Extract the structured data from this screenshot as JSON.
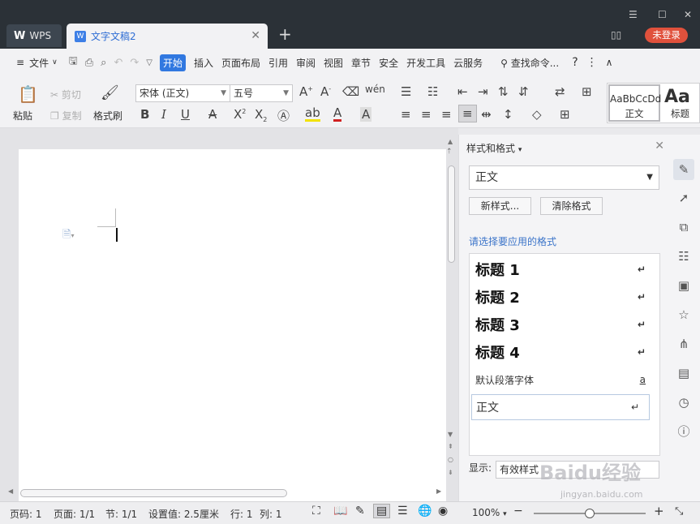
{
  "tabs": {
    "home": "WPS",
    "doc": "文字文稿2"
  },
  "window": {
    "login": "未登录"
  },
  "menu": {
    "file": "文件",
    "items": [
      "开始",
      "插入",
      "页面布局",
      "引用",
      "审阅",
      "视图",
      "章节",
      "安全",
      "开发工具",
      "云服务"
    ],
    "search": "查找命令...",
    "help": "?"
  },
  "ribbon": {
    "paste": "粘贴",
    "cut": "剪切",
    "copy": "复制",
    "format_painter": "格式刷",
    "font_name": "宋体 (正文)",
    "font_size": "五号",
    "gallery_normal_preview": "AaBbCcDd",
    "gallery_normal": "正文",
    "gallery_heading_preview": "Aa",
    "gallery_heading": "标题"
  },
  "panel": {
    "title": "样式和格式",
    "current_style": "正文",
    "new_style": "新样式...",
    "clear_format": "清除格式",
    "choose_label": "请选择要应用的格式",
    "styles": [
      {
        "name": "标题 1",
        "mark": "↵"
      },
      {
        "name": "标题 2",
        "mark": "↵"
      },
      {
        "name": "标题 3",
        "mark": "↵"
      },
      {
        "name": "标题 4",
        "mark": "↵"
      },
      {
        "name": "默认段落字体",
        "mark": "a"
      },
      {
        "name": "正文",
        "mark": "↵"
      }
    ],
    "show_label": "显示:",
    "show_value": "有效样式"
  },
  "status": {
    "page_no": "页码: 1",
    "pages": "页面: 1/1",
    "section": "节: 1/1",
    "setting": "设置值: 2.5厘米",
    "row": "行: 1",
    "col": "列: 1",
    "zoom": "100%",
    "zoom_level": 0.5
  },
  "watermark": {
    "main": "Baidu经验",
    "sub": "jingyan.baidu.com"
  }
}
